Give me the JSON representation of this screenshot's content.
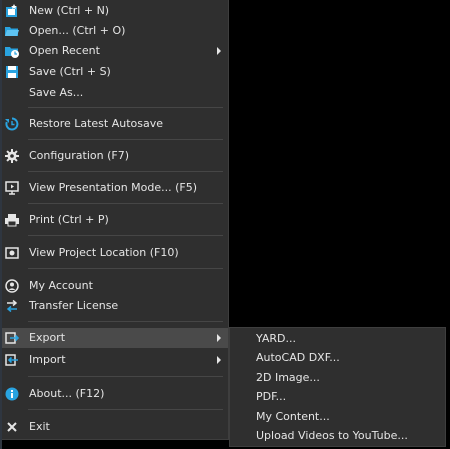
{
  "menu": {
    "items": [
      {
        "label": "New (Ctrl + N)",
        "icon": "new-file-icon"
      },
      {
        "label": "Open... (Ctrl + O)",
        "icon": "open-folder-icon"
      },
      {
        "label": "Open Recent",
        "icon": "open-recent-icon"
      },
      {
        "label": "Save (Ctrl + S)",
        "icon": "save-icon"
      },
      {
        "label": "Save As...",
        "icon": ""
      },
      {
        "label": "Restore Latest Autosave",
        "icon": "restore-icon"
      },
      {
        "label": "Configuration (F7)",
        "icon": "gear-icon"
      },
      {
        "label": "View Presentation Mode... (F5)",
        "icon": "presentation-icon"
      },
      {
        "label": "Print (Ctrl + P)",
        "icon": "printer-icon"
      },
      {
        "label": "View Project Location (F10)",
        "icon": "project-location-icon"
      },
      {
        "label": "My Account",
        "icon": "account-icon"
      },
      {
        "label": "Transfer License",
        "icon": "transfer-icon"
      },
      {
        "label": "Export",
        "icon": "export-icon"
      },
      {
        "label": "Import",
        "icon": "import-icon"
      },
      {
        "label": "About... (F12)",
        "icon": "info-icon"
      },
      {
        "label": "Exit",
        "icon": "close-icon"
      }
    ]
  },
  "submenu": {
    "items": [
      {
        "label": "YARD..."
      },
      {
        "label": "AutoCAD DXF..."
      },
      {
        "label": "2D Image..."
      },
      {
        "label": "PDF..."
      },
      {
        "label": "My Content..."
      },
      {
        "label": "Upload Videos to YouTube..."
      }
    ]
  },
  "colors": {
    "background": "#000000",
    "menu_bg": "#2f2f2f",
    "highlight": "#4a4a4a",
    "accent_blue": "#29a3e0",
    "text": "#e6e6e6"
  }
}
